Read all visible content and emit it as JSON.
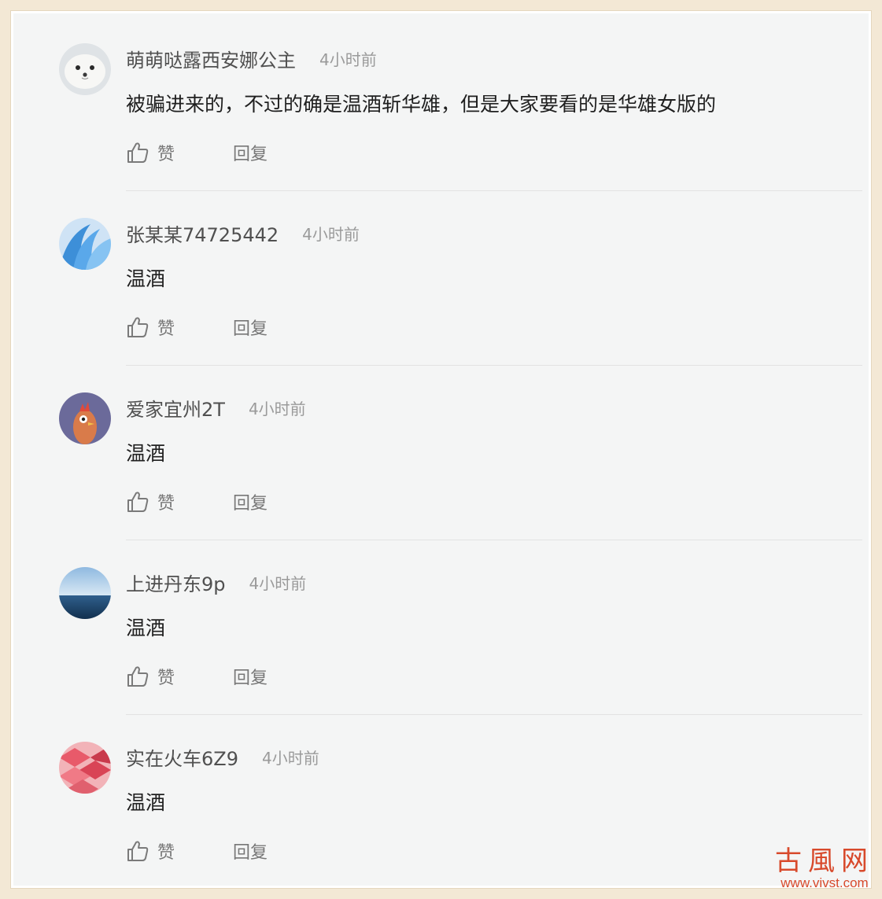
{
  "comments": [
    {
      "username": "萌萌哒露西安娜公主",
      "time": "4小时前",
      "text": "被骗进来的，不过的确是温酒斩华雄，但是大家要看的是华雄女版的",
      "like_label": "赞",
      "reply_label": "回复",
      "avatar_icon": "seal-avatar"
    },
    {
      "username": "张某某74725442",
      "time": "4小时前",
      "text": "温酒",
      "like_label": "赞",
      "reply_label": "回复",
      "avatar_icon": "blue-waves-avatar"
    },
    {
      "username": "爱家宜州2T",
      "time": "4小时前",
      "text": "温酒",
      "like_label": "赞",
      "reply_label": "回复",
      "avatar_icon": "cartoon-bird-avatar"
    },
    {
      "username": "上进丹东9p",
      "time": "4小时前",
      "text": "温酒",
      "like_label": "赞",
      "reply_label": "回复",
      "avatar_icon": "ocean-avatar"
    },
    {
      "username": "实在火车6Z9",
      "time": "4小时前",
      "text": "温酒",
      "like_label": "赞",
      "reply_label": "回复",
      "avatar_icon": "pink-cubes-avatar"
    }
  ],
  "watermark": {
    "title": "古風网",
    "url": "www.vivst.com"
  },
  "colors": {
    "background": "#f4f5f5",
    "frame": "#f3e8d5",
    "username": "#505050",
    "time": "#9a9a9a",
    "text": "#1f1f1f",
    "action": "#777777",
    "watermark": "#d84a2c"
  }
}
